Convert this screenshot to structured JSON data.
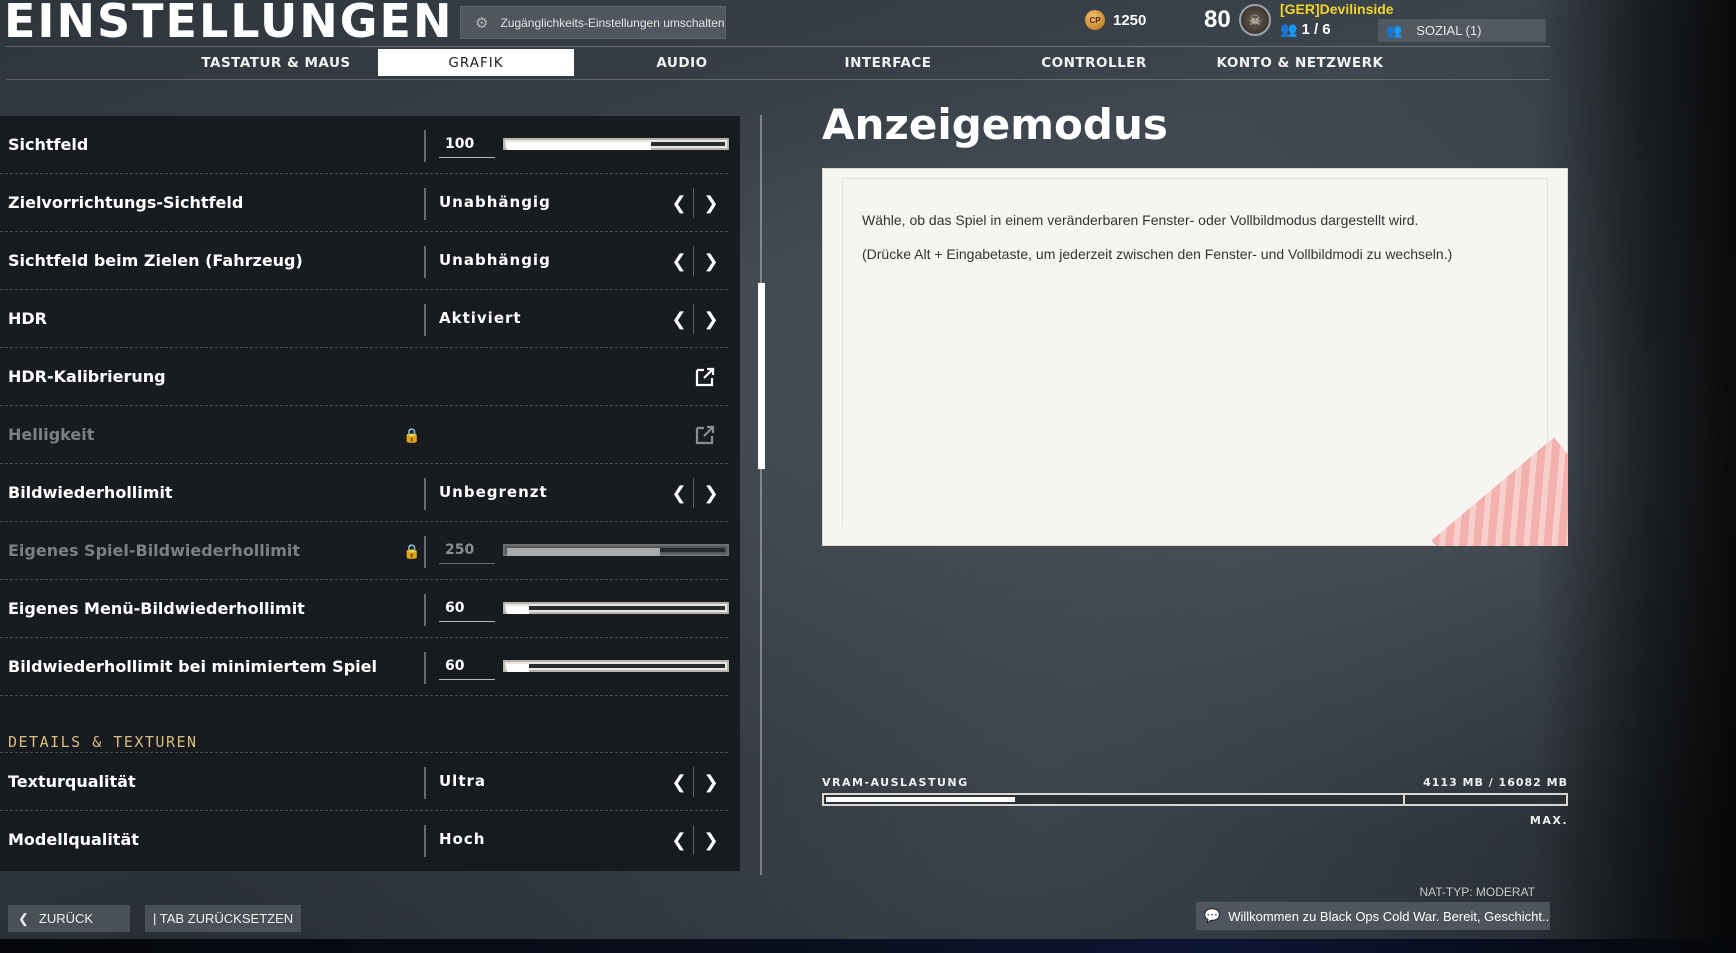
{
  "header": {
    "title": "EINSTELLUNGEN",
    "accessibility_button": "Zugänglichkeits-Einstellungen umschalten",
    "cp_icon_text": "CP",
    "cp_value": "1250",
    "level": "80",
    "player_name": "[GER]Devilinside",
    "party_count": "1 / 6",
    "social_label": "SOZIAL (1)"
  },
  "tabs": [
    {
      "label": "TASTATUR & MAUS",
      "active": false
    },
    {
      "label": "GRAFIK",
      "active": true
    },
    {
      "label": "AUDIO",
      "active": false
    },
    {
      "label": "INTERFACE",
      "active": false
    },
    {
      "label": "CONTROLLER",
      "active": false
    },
    {
      "label": "KONTO & NETZWERK",
      "active": false
    }
  ],
  "settings": [
    {
      "label": "Sichtfeld",
      "type": "slider",
      "value": "100",
      "fill": 0.66
    },
    {
      "label": "Zielvorrichtungs-Sichtfeld",
      "type": "select",
      "value": "Unabhängig"
    },
    {
      "label": "Sichtfeld beim Zielen (Fahrzeug)",
      "type": "select",
      "value": "Unabhängig"
    },
    {
      "label": "HDR",
      "type": "select",
      "value": "Aktiviert"
    },
    {
      "label": "HDR-Kalibrierung",
      "type": "launch"
    },
    {
      "label": "Helligkeit",
      "type": "launch",
      "locked": true
    },
    {
      "label": "Bildwiederhollimit",
      "type": "select",
      "value": "Unbegrenzt"
    },
    {
      "label": "Eigenes Spiel-Bildwiederhollimit",
      "type": "slider",
      "value": "250",
      "fill": 0.7,
      "locked": true
    },
    {
      "label": "Eigenes Menü-Bildwiederhollimit",
      "type": "slider",
      "value": "60",
      "fill": 0.1
    },
    {
      "label": "Bildwiederhollimit bei minimiertem Spiel",
      "type": "slider",
      "value": "60",
      "fill": 0.1
    }
  ],
  "section_details": {
    "title": "DETAILS & TEXTUREN",
    "settings": [
      {
        "label": "Texturqualität",
        "type": "select",
        "value": "Ultra"
      },
      {
        "label": "Modellqualität",
        "type": "select",
        "value": "Hoch"
      }
    ]
  },
  "description": {
    "title": "Anzeigemodus",
    "text1": "Wähle, ob das Spiel in einem veränderbaren Fenster- oder Vollbildmodus dargestellt wird.",
    "text2": "(Drücke Alt + Eingabetaste, um jederzeit zwischen den Fenster- und Vollbildmodi zu wechseln.)"
  },
  "vram": {
    "label": "VRAM-AUSLASTUNG",
    "value_text": "4113 MB / 16082 MB",
    "used_fraction": 0.256,
    "max_fraction": 0.78,
    "max_label": "MAX."
  },
  "footer": {
    "back_label": "ZURÜCK",
    "reset_label": "| TAB ZURÜCKSETZEN",
    "nat_type": "NAT-TYP: MODERAT",
    "chat_message": "Willkommen zu Black Ops Cold War. Bereit, Geschicht..."
  },
  "colors": {
    "section_header": "#d9bd7b",
    "player_name": "#f2d42a",
    "panel_bg": "#16191d"
  }
}
